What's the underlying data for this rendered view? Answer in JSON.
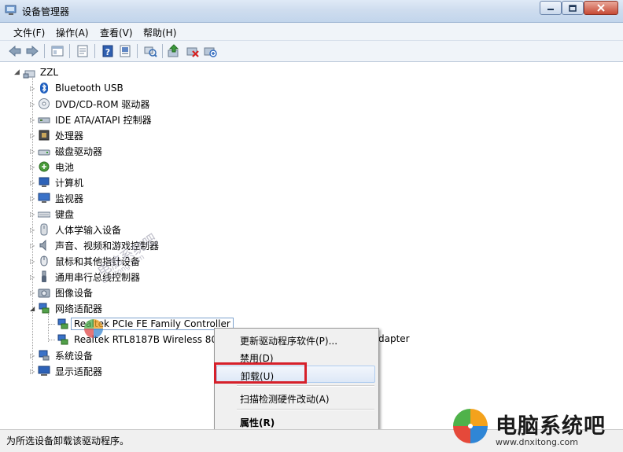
{
  "window": {
    "title": "设备管理器"
  },
  "menu": {
    "items": [
      "文件(F)",
      "操作(A)",
      "查看(V)",
      "帮助(H)"
    ]
  },
  "toolbar": {
    "icons": [
      "back-icon",
      "forward-icon",
      "tree-view-icon",
      "properties-icon",
      "help-icon",
      "show-hidden-icon",
      "update-driver-icon",
      "uninstall-icon",
      "scan-hardware-icon"
    ]
  },
  "tree": {
    "root": "ZZL",
    "categories": [
      "Bluetooth USB",
      "DVD/CD-ROM 驱动器",
      "IDE ATA/ATAPI 控制器",
      "处理器",
      "磁盘驱动器",
      "电池",
      "计算机",
      "监视器",
      "键盘",
      "人体学输入设备",
      "声音、视频和游戏控制器",
      "鼠标和其他指针设备",
      "通用串行总线控制器",
      "图像设备",
      "网络适配器"
    ],
    "network_children": [
      "Realtek PCIe FE Family Controller",
      "Realtek RTL8187B Wireless 802"
    ],
    "network_child2_suffix": "dapter",
    "categories_after": [
      "系统设备",
      "显示适配器"
    ]
  },
  "context_menu": {
    "items": [
      "更新驱动程序软件(P)...",
      "禁用(D)",
      "卸载(U)",
      "扫描检测硬件改动(A)",
      "属性(R)"
    ]
  },
  "status": {
    "text": "为所选设备卸载该驱动程序。"
  },
  "watermark": {
    "name": "电脑系统吧",
    "url": "www.dnxitong.com",
    "mid_text": "电脑系统吧",
    "mid_url": "dnxitong.com"
  }
}
